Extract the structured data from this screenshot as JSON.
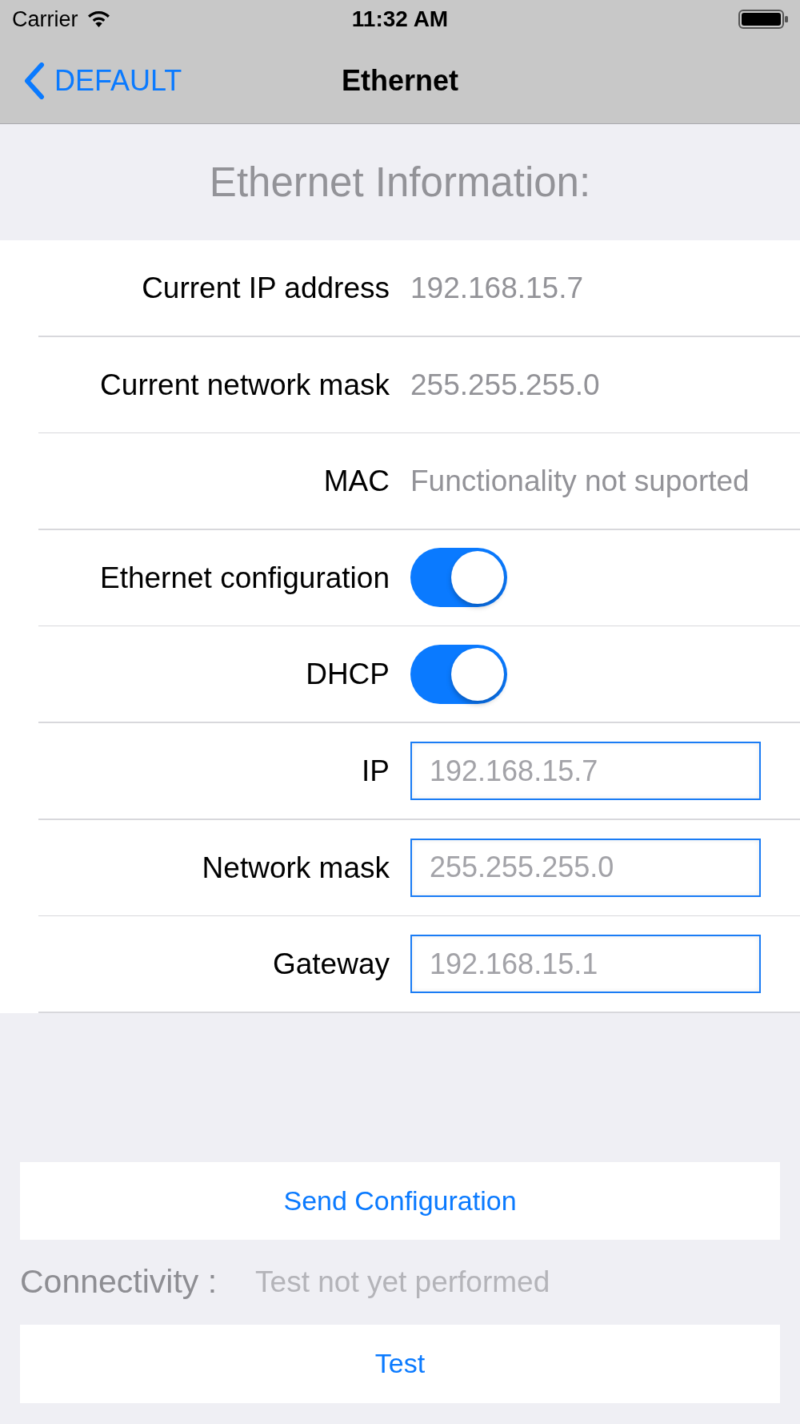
{
  "status_bar": {
    "carrier": "Carrier",
    "time": "11:32 AM"
  },
  "nav_bar": {
    "back_label": "DEFAULT",
    "title": "Ethernet"
  },
  "section_title": "Ethernet Information:",
  "rows": [
    {
      "kind": "value",
      "label": "Current IP address",
      "value": "192.168.15.7"
    },
    {
      "kind": "value",
      "label": "Current network mask",
      "value": "255.255.255.0"
    },
    {
      "kind": "value",
      "label": "MAC",
      "value": "Functionality not suported"
    },
    {
      "kind": "toggle",
      "label": "Ethernet configuration",
      "on": true
    },
    {
      "kind": "toggle",
      "label": "DHCP",
      "on": true
    },
    {
      "kind": "field",
      "label": "IP",
      "placeholder": "192.168.15.7"
    },
    {
      "kind": "field",
      "label": "Network mask",
      "placeholder": "255.255.255.0"
    },
    {
      "kind": "field",
      "label": "Gateway",
      "placeholder": "192.168.15.1"
    }
  ],
  "send_button": "Send Configuration",
  "connectivity": {
    "label": "Connectivity :",
    "value": "Test not yet performed"
  },
  "test_button": "Test"
}
